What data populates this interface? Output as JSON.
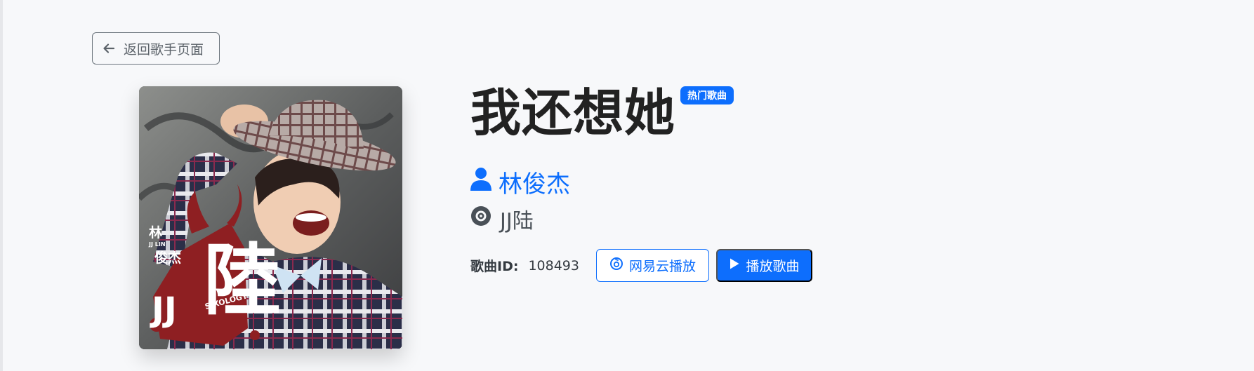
{
  "nav": {
    "back_label": "返回歌手页面"
  },
  "song": {
    "title": "我还想她",
    "badge": "热门歌曲",
    "artist": "林俊杰",
    "album": "JJ陆",
    "id_label": "歌曲ID:",
    "id_value": "108493"
  },
  "actions": {
    "netease_label": "网易云播放",
    "play_label": "播放歌曲"
  },
  "cover": {
    "name_text": "林",
    "name_text_2": "俊杰",
    "sub_text": "JJ LIN",
    "logo_text": "陸",
    "jj_text": "JJ",
    "sixology_text": "SIXOLOGY"
  },
  "colors": {
    "primary": "#0d6efd",
    "background": "#f7f8fa",
    "title": "#222222",
    "muted": "#6c757d"
  },
  "icons": {
    "back": "arrow-left-icon",
    "artist": "person-icon",
    "album": "disc-icon",
    "netease": "netease-icon",
    "play": "play-icon"
  }
}
